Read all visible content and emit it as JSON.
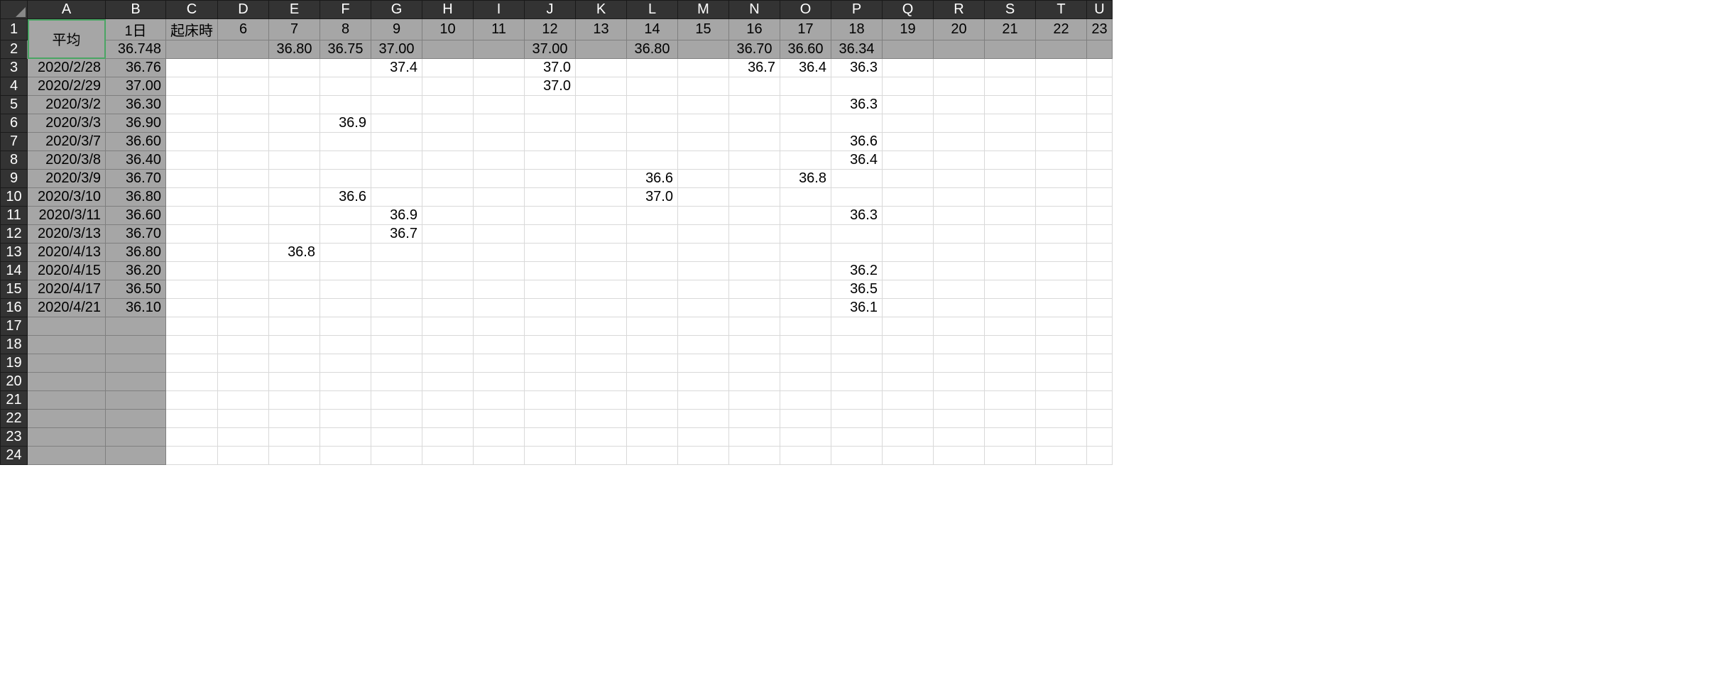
{
  "columns": [
    "A",
    "B",
    "C",
    "D",
    "E",
    "F",
    "G",
    "H",
    "I",
    "J",
    "K",
    "L",
    "M",
    "N",
    "O",
    "P",
    "Q",
    "R",
    "S",
    "T",
    "U"
  ],
  "row_numbers": [
    1,
    2,
    3,
    4,
    5,
    6,
    7,
    8,
    9,
    10,
    11,
    12,
    13,
    14,
    15,
    16,
    17,
    18,
    19,
    20,
    21,
    22,
    23,
    24
  ],
  "merged_A": "平均",
  "header_row1": {
    "B": "1日",
    "C": "起床時",
    "D": "6",
    "E": "7",
    "F": "8",
    "G": "9",
    "H": "10",
    "I": "11",
    "J": "12",
    "K": "13",
    "L": "14",
    "M": "15",
    "N": "16",
    "O": "17",
    "P": "18",
    "Q": "19",
    "R": "20",
    "S": "21",
    "T": "22",
    "U": "23"
  },
  "header_row2": {
    "B": "36.748",
    "E": "36.80",
    "F": "36.75",
    "G": "37.00",
    "J": "37.00",
    "L": "36.80",
    "N": "36.70",
    "O": "36.60",
    "P": "36.34"
  },
  "data_rows": [
    {
      "A": "2020/2/28",
      "B": "36.76",
      "G": "37.4",
      "J": "37.0",
      "N": "36.7",
      "O": "36.4",
      "P": "36.3"
    },
    {
      "A": "2020/2/29",
      "B": "37.00",
      "J": "37.0"
    },
    {
      "A": "2020/3/2",
      "B": "36.30",
      "P": "36.3"
    },
    {
      "A": "2020/3/3",
      "B": "36.90",
      "F": "36.9"
    },
    {
      "A": "2020/3/7",
      "B": "36.60",
      "P": "36.6"
    },
    {
      "A": "2020/3/8",
      "B": "36.40",
      "P": "36.4"
    },
    {
      "A": "2020/3/9",
      "B": "36.70",
      "L": "36.6",
      "O": "36.8"
    },
    {
      "A": "2020/3/10",
      "B": "36.80",
      "F": "36.6",
      "L": "37.0"
    },
    {
      "A": "2020/3/11",
      "B": "36.60",
      "G": "36.9",
      "P": "36.3"
    },
    {
      "A": "2020/3/13",
      "B": "36.70",
      "G": "36.7"
    },
    {
      "A": "2020/4/13",
      "B": "36.80",
      "E": "36.8"
    },
    {
      "A": "2020/4/15",
      "B": "36.20",
      "P": "36.2"
    },
    {
      "A": "2020/4/17",
      "B": "36.50",
      "P": "36.5"
    },
    {
      "A": "2020/4/21",
      "B": "36.10",
      "P": "36.1"
    }
  ],
  "blank_rows_after": 8
}
